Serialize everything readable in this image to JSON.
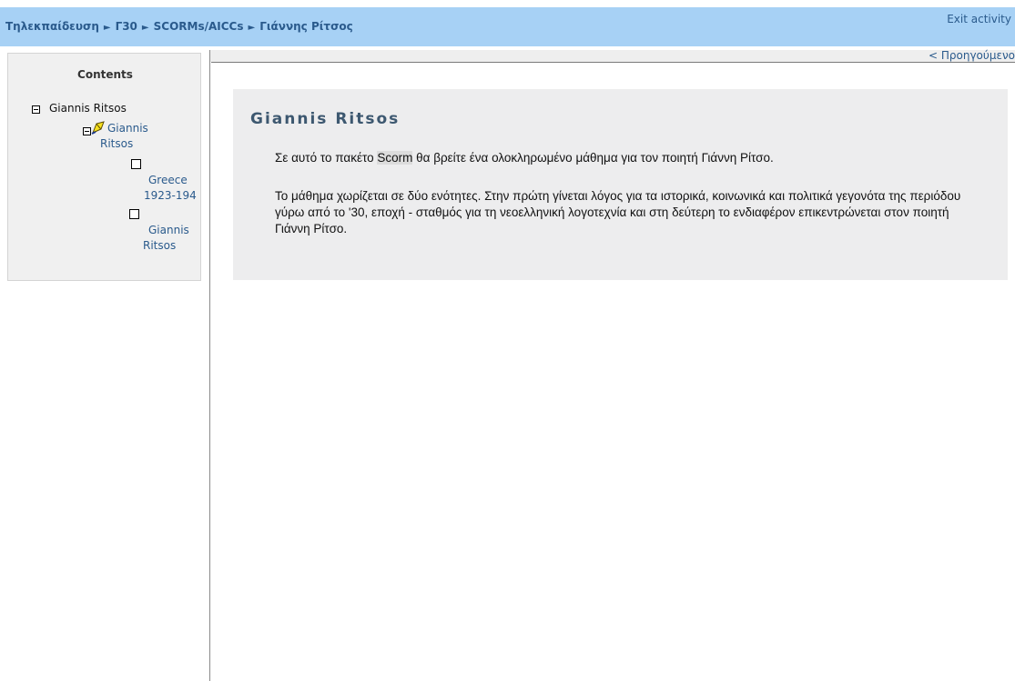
{
  "header": {
    "breadcrumb": [
      "Τηλεκπαίδευση",
      "Γ30",
      "SCORMs/AICCs",
      "Γιάννης Ρίτσος"
    ],
    "separator": "►",
    "exit_label": "Exit activity"
  },
  "sidebar": {
    "title": "Contents",
    "tree": {
      "root_label": "Giannis Ritsos",
      "child_label_line1": "Giannis",
      "child_label_line2": "Ritsos",
      "items": [
        {
          "line1": "Greece",
          "line2": "1923-194"
        },
        {
          "line1": "Giannis",
          "line2": "Ritsos"
        }
      ]
    }
  },
  "nav": {
    "prev_label": "< Προηγούμενο"
  },
  "content": {
    "title": "Giannis Ritsos",
    "p1_before": "Σε αυτό το πακέτο ",
    "p1_highlight": "Scorm",
    "p1_after": " θα βρείτε ένα ολοκληρωμένο μάθημα για τον ποιητή Γιάννη Ρίτσο.",
    "p2": "Το μάθημα χωρίζεται σε δύο ενότητες. Στην πρώτη γίνεται λόγος για τα ιστορικά, κοινωνικά και πολιτικά γεγονότα της περιόδου γύρω από το '30, εποχή - σταθμός για τη νεοελληνική λογοτεχνία και στη δεύτερη το ενδιαφέρον επικεντρώνεται στον ποιητή Γιάννη Ρίτσο."
  }
}
